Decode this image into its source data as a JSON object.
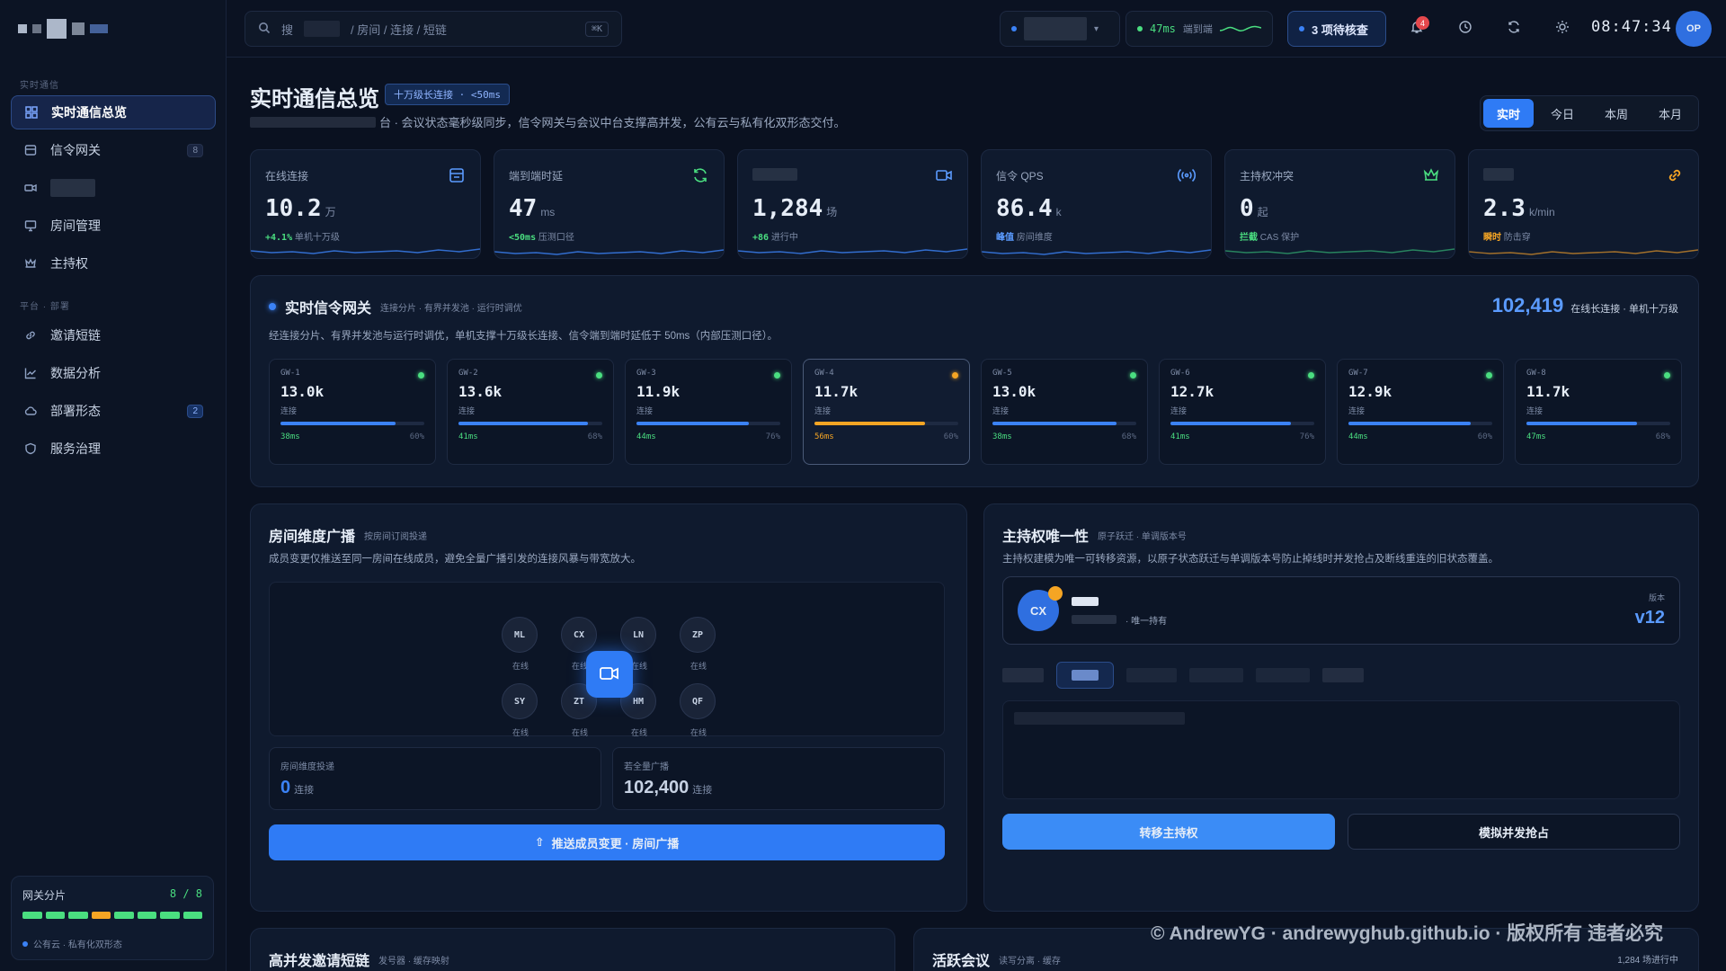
{
  "app": {
    "clock": "08:47:34",
    "avatar": "OP"
  },
  "colors": {
    "bg": "#0a1120",
    "panel": "#0f1a2e",
    "accent": "#2f7bf5",
    "ok": "#4ade80",
    "warn": "#f5a524"
  },
  "sidebar": {
    "section1": "实时通信",
    "section2": "平台 · 部署",
    "items": [
      {
        "label": "实时通信总览",
        "icon": "grid-icon",
        "active": true,
        "badge": ""
      },
      {
        "label": "信令网关",
        "icon": "server-icon",
        "badge": "8"
      },
      {
        "label": "",
        "icon": "video-icon",
        "badge": ""
      },
      {
        "label": "房间管理",
        "icon": "monitor-icon",
        "badge": ""
      },
      {
        "label": "主持权",
        "icon": "crown-icon",
        "badge": ""
      },
      {
        "label": "邀请短链",
        "icon": "link-icon",
        "badge": ""
      },
      {
        "label": "数据分析",
        "icon": "chart-icon",
        "badge": ""
      },
      {
        "label": "部署形态",
        "icon": "cloud-icon",
        "badge": "2"
      },
      {
        "label": "服务治理",
        "icon": "shield-icon",
        "badge": ""
      }
    ],
    "shard": {
      "label": "网关分片",
      "count": "8 / 8",
      "states": [
        "ok",
        "ok",
        "ok",
        "warn",
        "ok",
        "ok",
        "ok",
        "ok"
      ],
      "footer": "公有云 · 私有化双形态"
    }
  },
  "topbar": {
    "search_prefix": "搜",
    "search_hint": "/ 房间 / 连接 / 短链",
    "search_kbd": "⌘K",
    "latency_value": "47ms",
    "latency_label": "端到端",
    "pending_label": "3 项待核查",
    "notif_count": "4"
  },
  "header": {
    "title": "实时通信总览",
    "badge": "十万级长连接 · <50ms",
    "subtitle_tail": "台 · 会议状态毫秒级同步，信令网关与会议中台支撑高并发，公有云与私有化双形态交付。",
    "ranges": [
      "实时",
      "今日",
      "本周",
      "本月"
    ],
    "active_range": "实时"
  },
  "kpis": [
    {
      "label": "在线连接",
      "value": "10.2",
      "unit": "万",
      "delta": "+4.1%",
      "delta_color": "ok",
      "note": "单机十万级",
      "icon": "server-icon",
      "spark_color": "#3b82f6"
    },
    {
      "label": "端到端时延",
      "value": "47",
      "unit": "ms",
      "delta": "<50ms",
      "delta_color": "ok",
      "note": "压测口径",
      "icon": "refresh-icon",
      "spark_color": "#3b82f6"
    },
    {
      "label": "",
      "value": "1,284",
      "unit": "场",
      "delta": "+86",
      "delta_color": "ok",
      "note": "进行中",
      "icon": "video-icon",
      "spark_color": "#3b82f6"
    },
    {
      "label": "信令 QPS",
      "value": "86.4",
      "unit": "k",
      "delta": "峰值",
      "delta_color": "accent",
      "note": "房间维度",
      "icon": "signal-icon",
      "spark_color": "#3b82f6"
    },
    {
      "label": "主持权冲突",
      "value": "0",
      "unit": "起",
      "delta": "拦截",
      "delta_color": "ok",
      "note": "CAS 保护",
      "icon": "crown-icon",
      "spark_color": "#2e9d6a"
    },
    {
      "label": "",
      "value": "2.3",
      "unit": "k/min",
      "delta": "瞬时",
      "delta_color": "warn",
      "note": "防击穿",
      "icon": "link-icon",
      "spark_color": "#c7862a"
    }
  ],
  "gateway": {
    "title": "实时信令网关",
    "tags": "连接分片 · 有界并发池 · 运行时调优",
    "desc": "经连接分片、有界并发池与运行时调优，单机支撑十万级长连接、信令端到端时延低于 50ms（内部压测口径）。",
    "total": "102,419",
    "total_label": "在线长连接 · 单机十万级",
    "conn_label": "连接",
    "nodes": [
      {
        "id": "GW-1",
        "value": "13.0k",
        "latency": "38ms",
        "load": "60%",
        "fill": 0.8,
        "status": "ok"
      },
      {
        "id": "GW-2",
        "value": "13.6k",
        "latency": "41ms",
        "load": "68%",
        "fill": 0.9,
        "status": "ok"
      },
      {
        "id": "GW-3",
        "value": "11.9k",
        "latency": "44ms",
        "load": "76%",
        "fill": 0.78,
        "status": "ok"
      },
      {
        "id": "GW-4",
        "value": "11.7k",
        "latency": "56ms",
        "load": "60%",
        "fill": 0.77,
        "status": "warn"
      },
      {
        "id": "GW-5",
        "value": "13.0k",
        "latency": "38ms",
        "load": "68%",
        "fill": 0.86,
        "status": "ok"
      },
      {
        "id": "GW-6",
        "value": "12.7k",
        "latency": "41ms",
        "load": "76%",
        "fill": 0.84,
        "status": "ok"
      },
      {
        "id": "GW-7",
        "value": "12.9k",
        "latency": "44ms",
        "load": "60%",
        "fill": 0.85,
        "status": "ok"
      },
      {
        "id": "GW-8",
        "value": "11.7k",
        "latency": "47ms",
        "load": "68%",
        "fill": 0.77,
        "status": "ok"
      }
    ]
  },
  "room": {
    "title": "房间维度广播",
    "tag": "按房间订阅投递",
    "desc": "成员变更仅推送至同一房间在线成员，避免全量广播引发的连接风暴与带宽放大。",
    "members": [
      {
        "initials": "ML",
        "status": "在线"
      },
      {
        "initials": "CX",
        "status": "在线"
      },
      {
        "initials": "LN",
        "status": "在线"
      },
      {
        "initials": "ZP",
        "status": "在线"
      },
      {
        "initials": "SY",
        "status": "在线"
      },
      {
        "initials": "ZT",
        "status": "在线"
      },
      {
        "initials": "HM",
        "status": "在线"
      },
      {
        "initials": "QF",
        "status": "在线"
      }
    ],
    "stat1_label": "房间维度投递",
    "stat1_value": "0",
    "stat1_unit": "连接",
    "stat2_label": "若全量广播",
    "stat2_value": "102,400",
    "stat2_unit": "连接",
    "button": "推送成员变更 · 房间广播"
  },
  "host": {
    "title": "主持权唯一性",
    "tags": "原子跃迁 · 单调版本号",
    "desc": "主持权建模为唯一可转移资源，以原子状态跃迁与单调版本号防止掉线时并发抢占及断线重连的旧状态覆盖。",
    "avatar": "CX",
    "holder_note": "· 唯一持有",
    "version_label": "版本",
    "version": "v12",
    "transfer_button": "转移主持权",
    "simulate_button": "模拟并发抢占"
  },
  "bottom": {
    "left_title": "高并发邀请短链",
    "left_tags": "发号器 · 缓存映射",
    "right_title": "活跃会议",
    "right_tags": "读写分离 · 缓存",
    "right_count": "1,284 场进行中"
  },
  "watermark": "© AndrewYG · andrewyghub.github.io · 版权所有 违者必究"
}
